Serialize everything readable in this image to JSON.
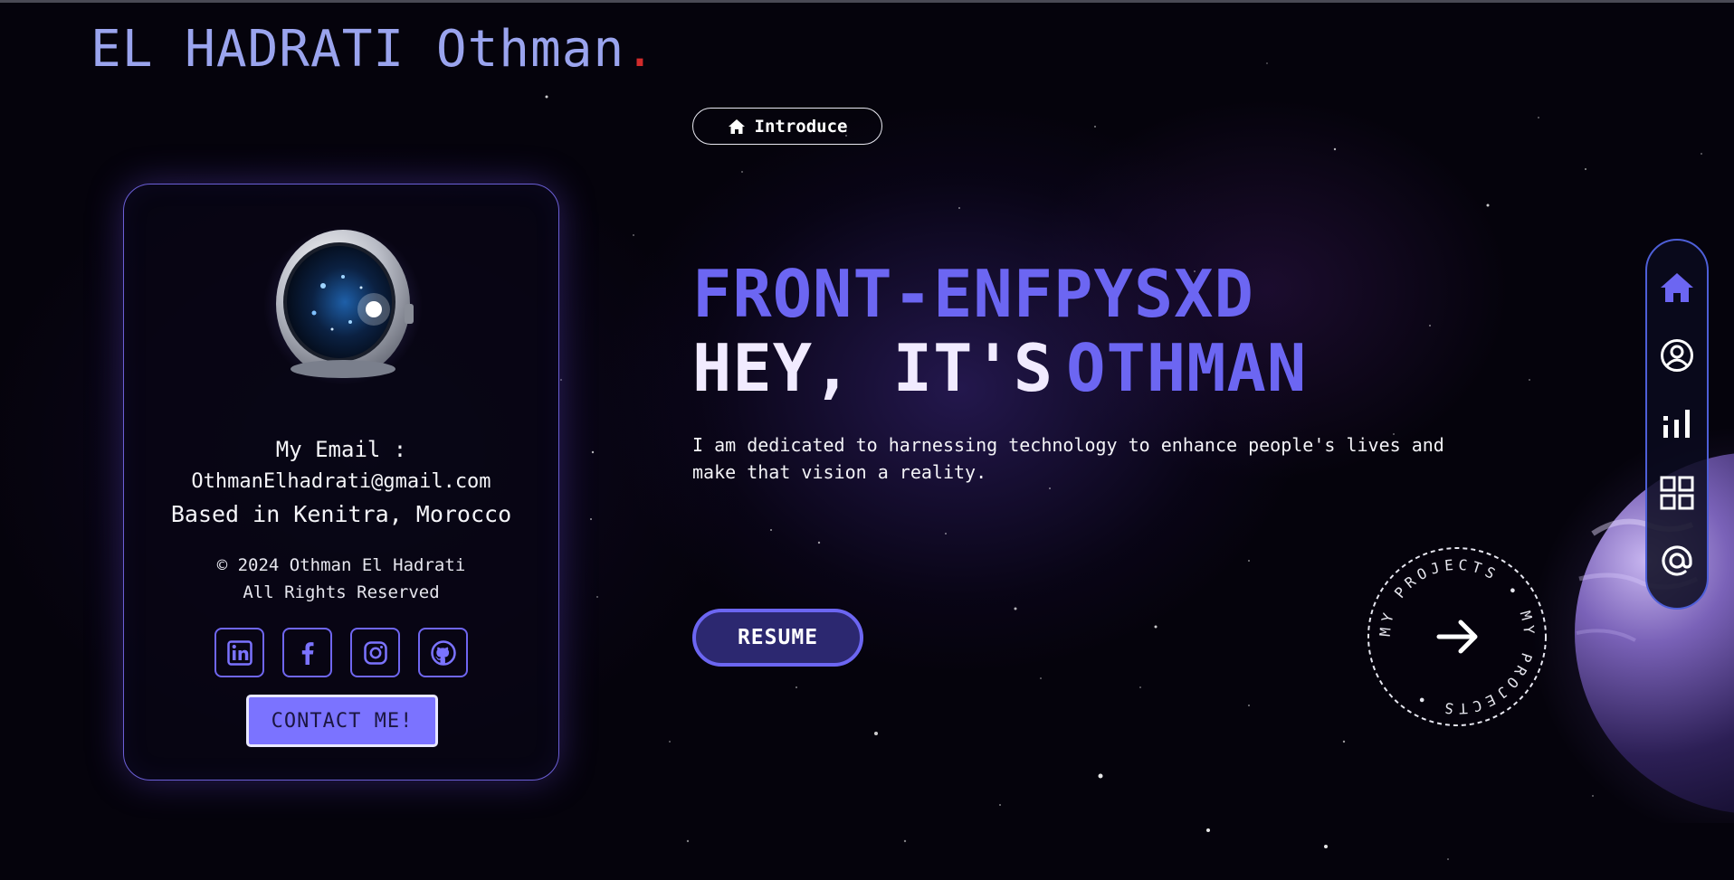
{
  "brand": {
    "name": "EL HADRATI Othman",
    "dot": "."
  },
  "profile": {
    "email_label": "My Email :",
    "email": "OthmanElhadrati@gmail.com",
    "location": "Based in Kenitra, Morocco",
    "copyright": "© 2024 Othman El Hadrati",
    "rights": "All Rights Reserved",
    "socials": [
      {
        "icon": "linkedin-icon"
      },
      {
        "icon": "facebook-icon"
      },
      {
        "icon": "instagram-icon"
      },
      {
        "icon": "github-icon"
      }
    ],
    "contact_label": "CONTACT ME!"
  },
  "intro": {
    "label": "Introduce",
    "icon": "home-icon"
  },
  "hero": {
    "role": "FRONT-ENFPYSXD",
    "greeting": "HEY, IT'S",
    "name": "OTHMAN",
    "description": "I am dedicated to harnessing technology to enhance people's lives and make that vision a reality.",
    "resume_label": "RESUME"
  },
  "projects_badge": {
    "text": "MY PROJECTS • MY PROJECTS • ",
    "icon": "arrow-right-icon"
  },
  "side_nav": [
    {
      "icon": "home-icon",
      "active": true
    },
    {
      "icon": "user-icon",
      "active": false
    },
    {
      "icon": "stats-icon",
      "active": false
    },
    {
      "icon": "grid-icon",
      "active": false
    },
    {
      "icon": "at-icon",
      "active": false
    }
  ],
  "colors": {
    "accent": "#6c66f2",
    "brand_text": "#9aa4ee",
    "background": "#05030c",
    "brand_dot": "#d12b2b"
  }
}
